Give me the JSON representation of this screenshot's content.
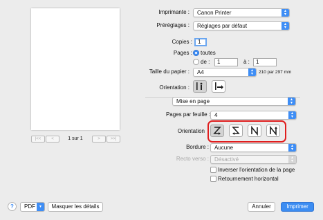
{
  "printer": {
    "label": "Imprimante :",
    "value": "Canon Printer"
  },
  "presets": {
    "label": "Préréglages :",
    "value": "Réglages par défaut"
  },
  "copies": {
    "label": "Copies :",
    "value": "1"
  },
  "pages": {
    "label": "Pages :",
    "all_label": "toutes",
    "from_label": "de :",
    "from_value": "1",
    "to_label": "à :",
    "to_value": "1",
    "selected": "toutes"
  },
  "paper_size": {
    "label": "Taille du papier :",
    "value": "A4",
    "dimensions": "210 par 297 mm"
  },
  "orientation": {
    "label": "Orientation :",
    "options": [
      "portrait-icon",
      "landscape-icon"
    ],
    "selected": 0
  },
  "section": {
    "value": "Mise en page"
  },
  "layout": {
    "pages_per_sheet_label": "Pages par feuille :",
    "pages_per_sheet_value": "4",
    "direction_label": "Orientation",
    "direction_options": [
      "z-layout-icon",
      "reverse-s-layout-icon",
      "n-reverse-layout-icon",
      "n-layout-icon"
    ],
    "direction_selected": 0,
    "border_label": "Bordure :",
    "border_value": "Aucune",
    "duplex_label": "Recto verso :",
    "duplex_value": "Désactivé",
    "reverse_orientation_label": "Inverser l'orientation de la page",
    "reverse_orientation_checked": false,
    "flip_horizontal_label": "Retournement horizontal",
    "flip_horizontal_checked": false
  },
  "preview": {
    "page_indicator": "1 sur 1"
  },
  "footer": {
    "help_symbol": "?",
    "pdf_label": "PDF",
    "hide_details_label": "Masquer les détails",
    "cancel_label": "Annuler",
    "print_label": "Imprimer"
  },
  "colors": {
    "accent": "#3f8ef5",
    "highlight": "#e01d1d"
  }
}
